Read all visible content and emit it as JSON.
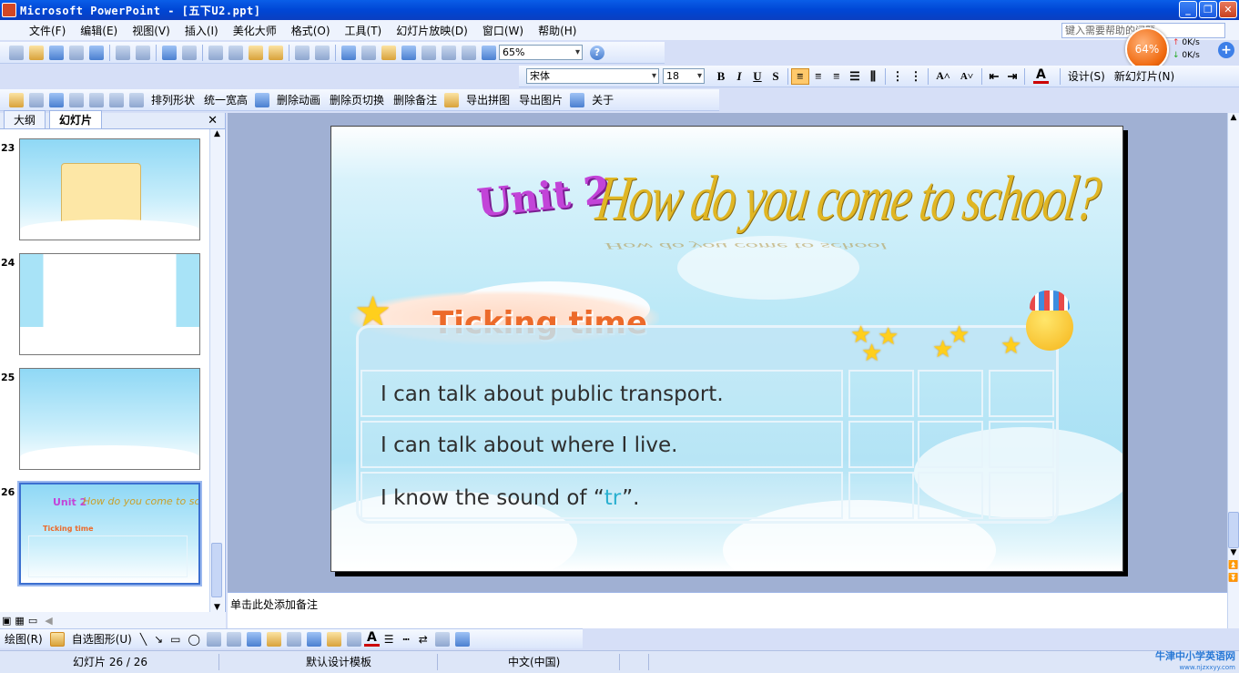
{
  "window": {
    "title": "Microsoft PowerPoint - [五下U2.ppt]",
    "btn_min": "_",
    "btn_max": "❐",
    "btn_close": "✕"
  },
  "menu": [
    "文件(F)",
    "编辑(E)",
    "视图(V)",
    "插入(I)",
    "美化大师",
    "格式(O)",
    "工具(T)",
    "幻灯片放映(D)",
    "窗口(W)",
    "帮助(H)"
  ],
  "help_box": "键入需要帮助的问题",
  "system_monitor": {
    "cpu": "64%",
    "upload": "0K/s",
    "download": "0K/s",
    "plus": "+"
  },
  "toolbar1": {
    "zoom": "65%",
    "help": "?"
  },
  "toolbar2": {
    "font": "宋体",
    "size": "18",
    "bold": "B",
    "italic": "I",
    "underline": "U",
    "shadow": "S",
    "grow": "A˄",
    "shrink": "A˅",
    "font_color": "A",
    "design": "设计(S)",
    "new_slide": "新幻灯片(N)"
  },
  "toolbar3": [
    "排列形状",
    "统一宽高",
    "删除动画",
    "删除页切换",
    "删除备注",
    "导出拼图",
    "导出图片",
    "关于"
  ],
  "left_pane": {
    "tab_outline": "大纲",
    "tab_slides": "幻灯片",
    "close": "✕",
    "slides": [
      {
        "num": "23"
      },
      {
        "num": "24"
      },
      {
        "num": "25"
      },
      {
        "num": "26"
      }
    ]
  },
  "slide": {
    "unit": "Unit 2",
    "title": "How do you come to school?",
    "title_reflection": "How do you come to school",
    "section": "Ticking time",
    "rows": [
      {
        "text": "I can talk about public transport."
      },
      {
        "text": "I can talk about where I live."
      },
      {
        "text_before": "I know the sound of “",
        "highlight": "tr",
        "text_after": "”."
      }
    ]
  },
  "notes_placeholder": "单击此处添加备注",
  "draw_toolbar": {
    "draw": "绘图(R)",
    "autoshape": "自选图形(U)"
  },
  "status": {
    "slide": "幻灯片 26 / 26",
    "template": "默认设计模板",
    "language": "中文(中国)",
    "watermark": "牛津中小学英语网",
    "watermark_url": "www.njzxxyy.com"
  }
}
